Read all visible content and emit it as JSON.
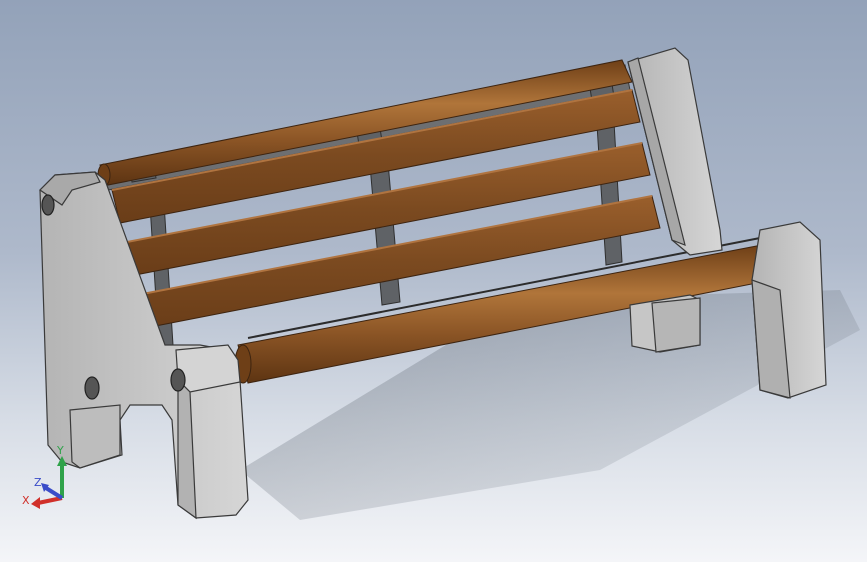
{
  "viewport": {
    "background_top": "#93a2b9",
    "background_bottom": "#f4f5f8"
  },
  "model": {
    "concrete_color": "#c9c9c9",
    "concrete_shade": "#a9a9a9",
    "wood_color": "#7a4a22",
    "wood_highlight": "#a56930",
    "rail_color": "#6e6e6e"
  },
  "triad": {
    "x_label": "X",
    "y_label": "Y",
    "z_label": "Z",
    "x_color": "#d0302a",
    "y_color": "#2fa24a",
    "z_color": "#3a4cc8"
  }
}
